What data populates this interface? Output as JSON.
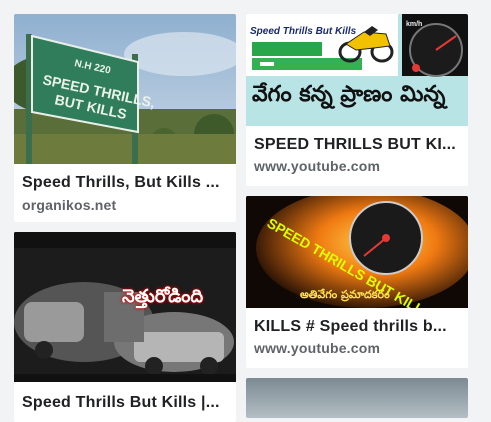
{
  "results": [
    {
      "title": "Speed Thrills, But Kills ...",
      "source": "organikos.net",
      "sign": {
        "line1": "N.H 220",
        "line2": "SPEED THRILLS,",
        "line3": "BUT KILLS"
      }
    },
    {
      "title": "SPEED THRILLS BUT KI...",
      "source": "www.youtube.com",
      "banner": "Speed Thrills But Kills",
      "speedo_label": "km/h",
      "telugu_text": "వేగం కన్న ప్రాణం మిన్న"
    },
    {
      "title": "KILLS # Speed thrills b...",
      "source": "www.youtube.com",
      "overlay_text": "SPEED THRILLS BUT KILLS",
      "telugu_caption": "అతివేగం ప్రమాదకరం"
    },
    {
      "title": "Speed Thrills But Kills |...",
      "source": "",
      "telugu_overlay": "నెత్తురోడింది"
    }
  ],
  "colors": {
    "card_bg": "#ffffff",
    "page_bg": "#f1f3f4",
    "title": "#202124",
    "source": "#5f6368",
    "sign_green": "#2f7d5b",
    "thumb2_bg": "#b9e4e6"
  }
}
